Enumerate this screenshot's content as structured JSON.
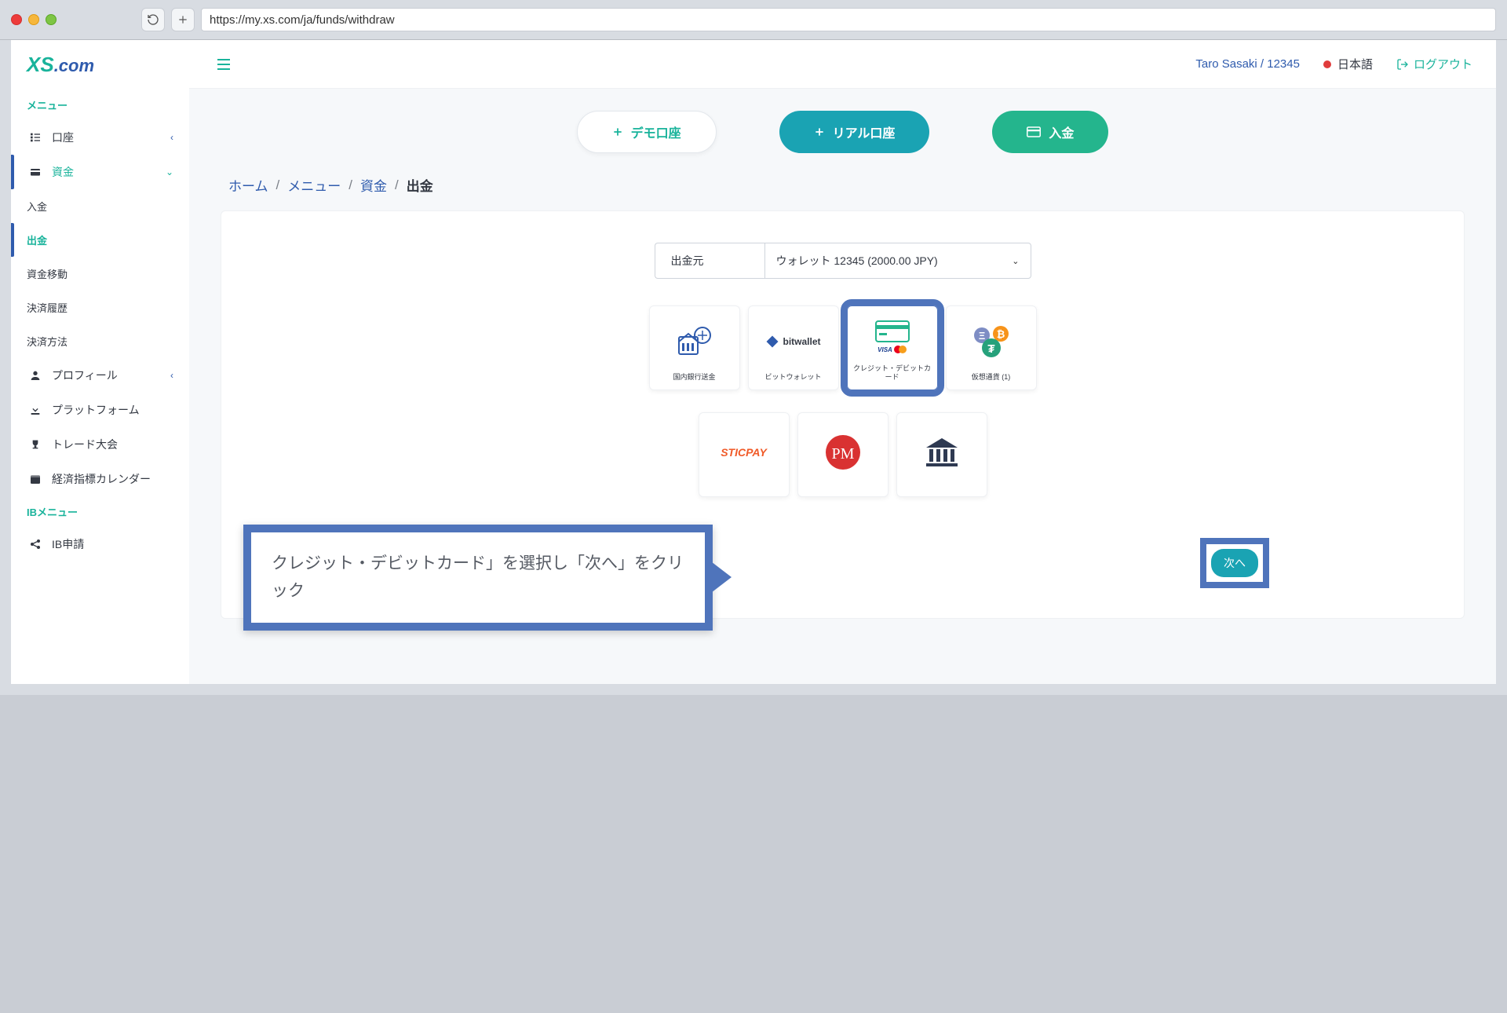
{
  "browser": {
    "url": "https://my.xs.com/ja/funds/withdraw"
  },
  "logo": {
    "xs": "XS",
    "com": ".com"
  },
  "sidebar": {
    "menu_label": "メニュー",
    "items": {
      "account": {
        "label": "口座"
      },
      "funds": {
        "label": "資金"
      },
      "deposit": {
        "label": "入金"
      },
      "withdraw": {
        "label": "出金"
      },
      "transfer": {
        "label": "資金移動"
      },
      "history": {
        "label": "決済履歴"
      },
      "methods": {
        "label": "決済方法"
      },
      "profile": {
        "label": "プロフィール"
      },
      "platform": {
        "label": "プラットフォーム"
      },
      "contest": {
        "label": "トレード大会"
      },
      "calendar": {
        "label": "経済指標カレンダー"
      }
    },
    "ib_label": "IBメニュー",
    "ib_apply": {
      "label": "IB申請"
    }
  },
  "topbar": {
    "user": "Taro Sasaki / 12345",
    "lang": "日本語",
    "logout": "ログアウト"
  },
  "actions": {
    "demo": "デモ口座",
    "real": "リアル口座",
    "deposit": "入金"
  },
  "breadcrumb": {
    "home": "ホーム",
    "menu": "メニュー",
    "funds": "資金",
    "current": "出金"
  },
  "withdraw": {
    "source_label": "出金元",
    "source_value": "ウォレット 12345 (2000.00 JPY)",
    "methods": {
      "bank": "国内銀行送金",
      "bitwallet": "ビットウォレット",
      "bitwallet_brand": "bitwallet",
      "card": "クレジット・デビットカード",
      "crypto": "仮想通貨 (1)",
      "sticpay": "STICPAY",
      "pm": "PM"
    },
    "next": "次へ",
    "tooltip": "クレジット・デビットカード」を選択し「次へ」をクリック"
  }
}
